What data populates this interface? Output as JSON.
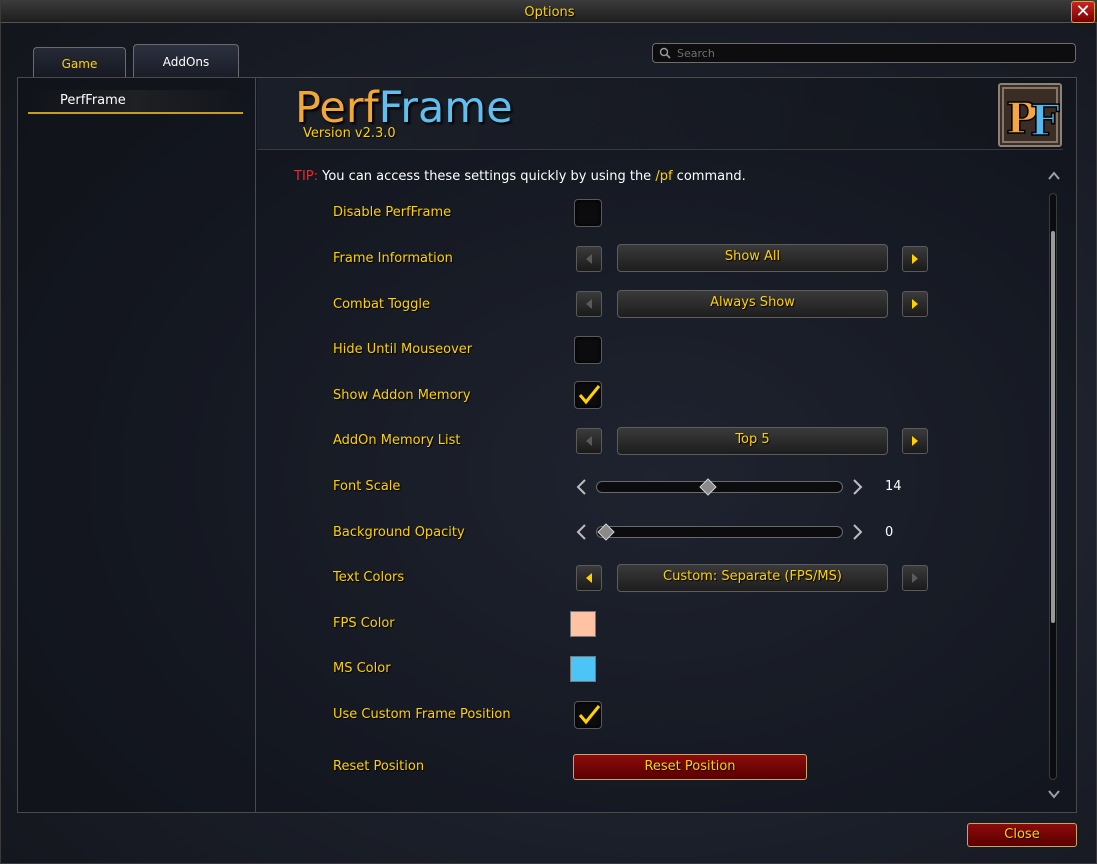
{
  "window": {
    "title": "Options"
  },
  "tabs": [
    {
      "label": "Game"
    },
    {
      "label": "AddOns"
    }
  ],
  "search": {
    "placeholder": "Search"
  },
  "sidebar": {
    "items": [
      {
        "label": "PerfFrame"
      }
    ]
  },
  "header": {
    "title_part1": "Perf",
    "title_part2": "Frame",
    "version": "Version v2.3.0",
    "icon": "pf-logo-icon"
  },
  "tip": {
    "label": "TIP:",
    "text_before": " You can access these settings quickly by using the ",
    "command": "/pf",
    "text_after": " command."
  },
  "settings": {
    "disable_perfframe": {
      "label": "Disable PerfFrame",
      "checked": false
    },
    "frame_information": {
      "label": "Frame Information",
      "value": "Show All"
    },
    "combat_toggle": {
      "label": "Combat Toggle",
      "value": "Always Show"
    },
    "hide_until_mouseover": {
      "label": "Hide Until Mouseover",
      "checked": false
    },
    "show_addon_memory": {
      "label": "Show Addon Memory",
      "checked": true
    },
    "addon_memory_list": {
      "label": "AddOn Memory List",
      "value": "Top 5"
    },
    "font_scale": {
      "label": "Font Scale",
      "value": "14",
      "fraction": 0.45
    },
    "background_opacity": {
      "label": "Background Opacity",
      "value": "0",
      "fraction": 0.0
    },
    "text_colors": {
      "label": "Text Colors",
      "value": "Custom: Separate (FPS/MS)"
    },
    "fps_color": {
      "label": "FPS Color",
      "color": "#ffc3a3"
    },
    "ms_color": {
      "label": "MS Color",
      "color": "#4cc4f5"
    },
    "use_custom_frame_position": {
      "label": "Use Custom Frame Position",
      "checked": true
    },
    "reset_position": {
      "label": "Reset Position",
      "button_label": "Reset Position"
    }
  },
  "footer": {
    "close_label": "Close"
  },
  "colors": {
    "accent_gold": "#ffd100",
    "tip_red": "#ff2020",
    "button_red": "#8d0b0b"
  }
}
